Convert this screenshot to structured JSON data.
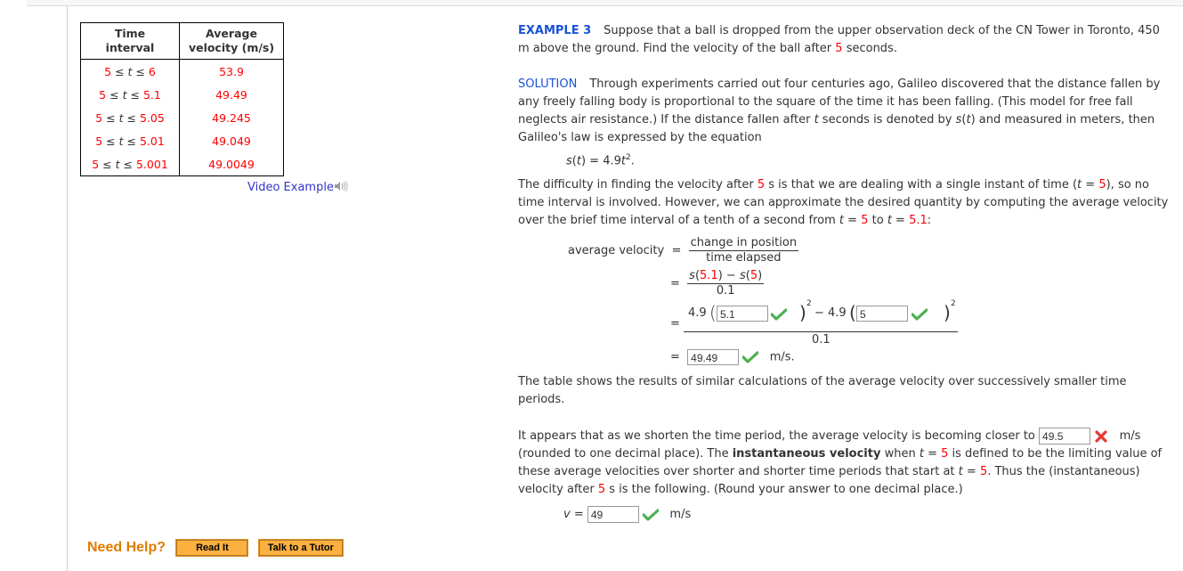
{
  "table": {
    "headers": [
      "Time interval",
      "Average velocity (m/s)"
    ],
    "header_lines": [
      [
        "Time",
        "interval"
      ],
      [
        "Average",
        "velocity (m/s)"
      ]
    ],
    "rows": [
      {
        "lo": "5",
        "var": "t",
        "hi": "6",
        "avg": "53.9"
      },
      {
        "lo": "5",
        "var": "t",
        "hi": "5.1",
        "avg": "49.49"
      },
      {
        "lo": "5",
        "var": "t",
        "hi": "5.05",
        "avg": "49.245"
      },
      {
        "lo": "5",
        "var": "t",
        "hi": "5.01",
        "avg": "49.049"
      },
      {
        "lo": "5",
        "var": "t",
        "hi": "5.001",
        "avg": "49.0049"
      }
    ],
    "le": "≤"
  },
  "video_example": {
    "label": "Video Example",
    "icon": "speaker-icon"
  },
  "example": {
    "label": "EXAMPLE 3",
    "text1": "Suppose that a ball is dropped from the upper observation deck of the CN Tower in Toronto, 450 m above the ground. Find the velocity of the ball after ",
    "text1_red": "5",
    "text1_end": " seconds."
  },
  "solution": {
    "label": "SOLUTION",
    "p1a": "Through experiments carried out four centuries ago, Galileo discovered that the distance fallen by any freely falling body is proportional to the square of the time it has been falling. (This model for free fall neglects air resistance.) If the distance fallen after ",
    "p1_t": "t",
    "p1b": " seconds is denoted by ",
    "p1_s": "s",
    "p1_t2": "t",
    "p1c": " and measured in meters, then Galileo's law is expressed by the equation",
    "eq_lhs_s": "s",
    "eq_lhs_t": "t",
    "eq_rhs": " = 4.9",
    "eq_rhs_t": "t",
    "eq_exp": "2",
    "p2a": "The difficulty in finding the velocity after ",
    "p2_red1": "5",
    "p2b": " s is that we are dealing with a single instant of time (",
    "p2_t": "t",
    "p2c": " = ",
    "p2_red2": "5",
    "p2d": "), so no time interval is involved. However, we can approximate the desired quantity by computing the average velocity over the brief time interval of a tenth of a second from ",
    "p2_t2": "t",
    "p2e": " = ",
    "p2_red3": "5",
    "p2f": " to ",
    "p2_t3": "t",
    "p2g": " = ",
    "p2_red4": "5.1",
    "p2h": ":"
  },
  "derivation": {
    "avg_label": "average velocity",
    "eq": "=",
    "frac1_num": "change in position",
    "frac1_den": "time elapsed",
    "frac2_s1": "s",
    "frac2_v1": "5.1",
    "frac2_minus": " − ",
    "frac2_s2": "s",
    "frac2_v2": "5",
    "frac2_den": "0.1",
    "coef": "4.9",
    "input1_value": "5.1",
    "input1_status": "correct",
    "exp": "2",
    "minus": "−",
    "input2_value": "5",
    "input2_status": "correct",
    "frac3_den": "0.1",
    "result_value": "49.49",
    "result_status": "correct",
    "result_unit": "m/s."
  },
  "table_note": "The table shows the results of similar calculations of the average velocity over successively smaller time periods.",
  "conclusion": {
    "a": "It appears that as we shorten the time period, the average velocity is becoming closer to ",
    "input_value": "49.5",
    "input_status": "incorrect",
    "unit": "m/s",
    "b": "(rounded to one decimal place). The ",
    "bold": "instantaneous velocity",
    "c": " when ",
    "t1": "t",
    "d": " = ",
    "red1": "5",
    "e": " is defined to be the limiting value of these average velocities over shorter and shorter time periods that start at ",
    "t2": "t",
    "f": " = ",
    "red2": "5",
    "g": ". Thus the (instantaneous) velocity after ",
    "red3": "5",
    "h": " s is the following. (Round your answer to one decimal place.)"
  },
  "final": {
    "var": "v",
    "eq": " = ",
    "input_value": "49",
    "input_status": "correct",
    "unit": "m/s"
  },
  "help": {
    "title": "Need Help?",
    "read_it": "Read It",
    "tutor": "Talk to a Tutor"
  },
  "colors": {
    "accent_blue": "#1a53d6",
    "value_red": "#ff0000",
    "link_blue": "#3333cc",
    "help_orange": "#e07b00",
    "button_orange": "#fbb040",
    "check_green": "#4caf50",
    "cross_red": "#e53935"
  }
}
